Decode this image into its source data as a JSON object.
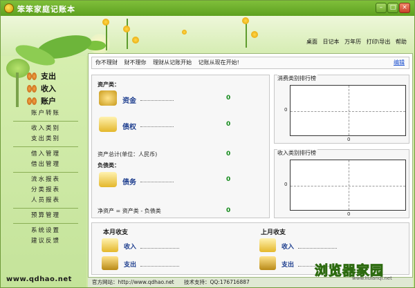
{
  "window": {
    "title": "笨笨家庭记账本",
    "minimize": "–",
    "maximize": "□",
    "close": "×"
  },
  "topmenu": [
    "桌面",
    "日记本",
    "万年历",
    "打印\\导出",
    "帮助"
  ],
  "sidebar": {
    "main": [
      "支出",
      "收入",
      "账户"
    ],
    "groups": [
      [
        "账户转账"
      ],
      [
        "收入类别",
        "支出类别"
      ],
      [
        "借入管理",
        "借出管理"
      ],
      [
        "流水报表",
        "分类报表",
        "人员报表"
      ],
      [
        "预算管理"
      ],
      [
        "系统设置",
        "建议反馈"
      ]
    ],
    "site": "www.qdhao.net"
  },
  "hintbar": {
    "items": [
      "你不理财",
      "财不理你",
      "理财从记账开始",
      "记账从现在开始!"
    ],
    "edit": "编辑"
  },
  "assets": {
    "assets_title": "资产类：",
    "cash": {
      "label": "资金",
      "value": "0"
    },
    "claims": {
      "label": "债权",
      "value": "0"
    },
    "total": {
      "label": "资产总计(单位：人民币)",
      "value": "0"
    },
    "liab_title": "负债类：",
    "debt": {
      "label": "债务",
      "value": "0"
    },
    "net": {
      "label": "净资产 = 资产类 - 负债类",
      "value": "0"
    }
  },
  "rank_expense": {
    "title": "消费类别排行榜",
    "y0": "0",
    "x0": "0"
  },
  "rank_income": {
    "title": "收入类别排行榜",
    "y0": "0",
    "x0": "0"
  },
  "monthly": {
    "this_month": "本月收支",
    "last_month": "上月收支",
    "income": "收入",
    "expense": "支出"
  },
  "footer": {
    "site": "官方网站：http://www.qdhao.net",
    "support": "技术支持：QQ:176716887"
  },
  "watermark": {
    "text": "浏览器家园",
    "url": "www.liulanqi.net"
  },
  "colors": {
    "accent": "#6aa82a",
    "value_green": "#138a1a",
    "label_blue": "#1f3f8f"
  }
}
